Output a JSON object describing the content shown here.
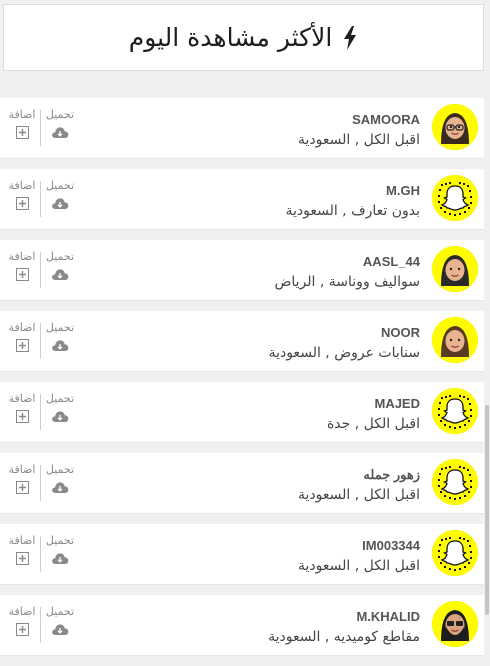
{
  "header": {
    "title": "الأكثر مشاهدة اليوم",
    "icon": "bolt-icon"
  },
  "actions": {
    "add_label": "اضافة",
    "download_label": "تحميل"
  },
  "colors": {
    "snap_yellow": "#fffc00",
    "icon_grey": "#8a8a8a"
  },
  "items": [
    {
      "username": "SAMOORA",
      "description": "اقبل الكل , السعودية",
      "avatar": "bitmoji-woman-glasses"
    },
    {
      "username": "M.GH",
      "description": "بدون تعارف , السعودية",
      "avatar": "snapcode-ghost"
    },
    {
      "username": "AASL_44",
      "description": "سواليف ووناسة , الرياض",
      "avatar": "bitmoji-woman-hijab"
    },
    {
      "username": "NOOR",
      "description": "سنابات عروض , السعودية",
      "avatar": "bitmoji-woman"
    },
    {
      "username": "MAJED",
      "description": "اقبل الكل , جدة",
      "avatar": "snapcode-ghost"
    },
    {
      "username": "زهور جمله",
      "description": "اقبل الكل , السعودية",
      "avatar": "snapcode-ghost"
    },
    {
      "username": "IM003344",
      "description": "اقبل الكل , السعودية",
      "avatar": "snapcode-ghost"
    },
    {
      "username": "M.KHALID",
      "description": "مقاطع كوميديه , السعودية",
      "avatar": "bitmoji-man-beard"
    }
  ]
}
